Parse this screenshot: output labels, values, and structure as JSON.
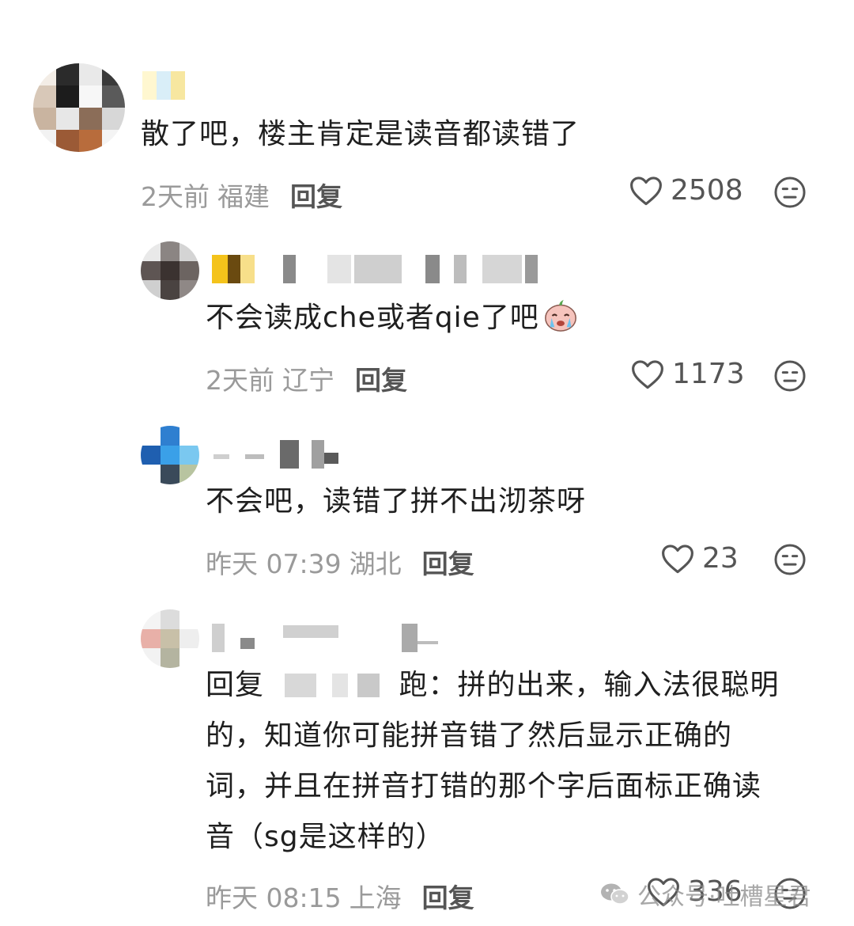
{
  "comments": [
    {
      "text": "散了吧，楼主肯定是读音都读错了",
      "time": "2天前",
      "location": "福建",
      "reply_label": "回复",
      "likes": "2508"
    },
    {
      "text": "不会读成che或者qie了吧",
      "emoji": "crying-face-emoji",
      "time": "2天前",
      "location": "辽宁",
      "reply_label": "回复",
      "likes": "1173"
    },
    {
      "text": "不会吧，读错了拼不出沏茶呀",
      "time": "昨天 07:39",
      "location": "湖北",
      "reply_label": "回复",
      "likes": "23"
    },
    {
      "reply_prefix": "回复",
      "mention_suffix": "跑：",
      "line1": "拼的出来，输入法很聪明",
      "line2": "的，知道你可能拼音错了然后显示正确的",
      "line3": "词，并且在拼音打错的那个字后面标正确读",
      "line4": "音（sg是这样的）",
      "time": "昨天 08:15",
      "location": "上海",
      "reply_label": "回复",
      "likes": "336"
    }
  ],
  "watermark": {
    "text": "公众号·吐槽星君",
    "icon": "wechat-icon"
  },
  "colors": {
    "text": "#1f1f1f",
    "meta": "#9a9a9a",
    "icon": "#555555"
  }
}
